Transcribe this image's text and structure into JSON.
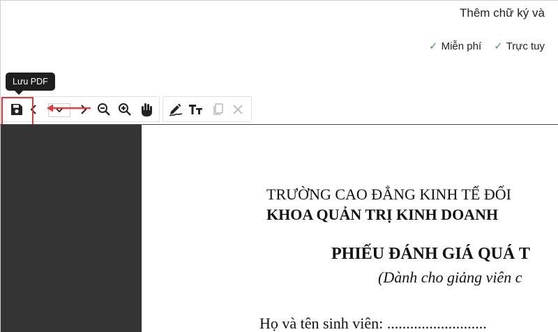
{
  "header": {
    "title": "Thêm chữ ký và",
    "features": [
      {
        "check": "✓",
        "label": "Miễn phí"
      },
      {
        "check": "✓",
        "label": "Trực tuy"
      }
    ]
  },
  "tooltip": {
    "text": "Lưu PDF"
  },
  "toolbar": {
    "page_select_value": "",
    "buttons": [
      "save-icon",
      "chevron-left-icon",
      "chevron-right-icon",
      "zoom-out-icon",
      "zoom-in-icon",
      "hand-pan-icon",
      "sign-pen-icon",
      "text-tool-icon",
      "copy-icon",
      "close-icon"
    ]
  },
  "annotation": {
    "highlight_color": "#e03a3a",
    "arrow_color": "#e03a3a"
  },
  "document": {
    "line1": "TRƯỜNG CAO ĐẲNG KINH TẾ ĐỐI",
    "line2": "KHOA QUẢN TRỊ KINH DOANH",
    "line3": "PHIẾU ĐÁNH GIÁ QUÁ T",
    "line4": "(Dành cho giảng viên c",
    "line5": "Họ và tên sinh viên: .........................."
  },
  "colors": {
    "sidebar": "#343434",
    "tooltip_bg": "#1e1e1e",
    "check": "#3aa657"
  }
}
